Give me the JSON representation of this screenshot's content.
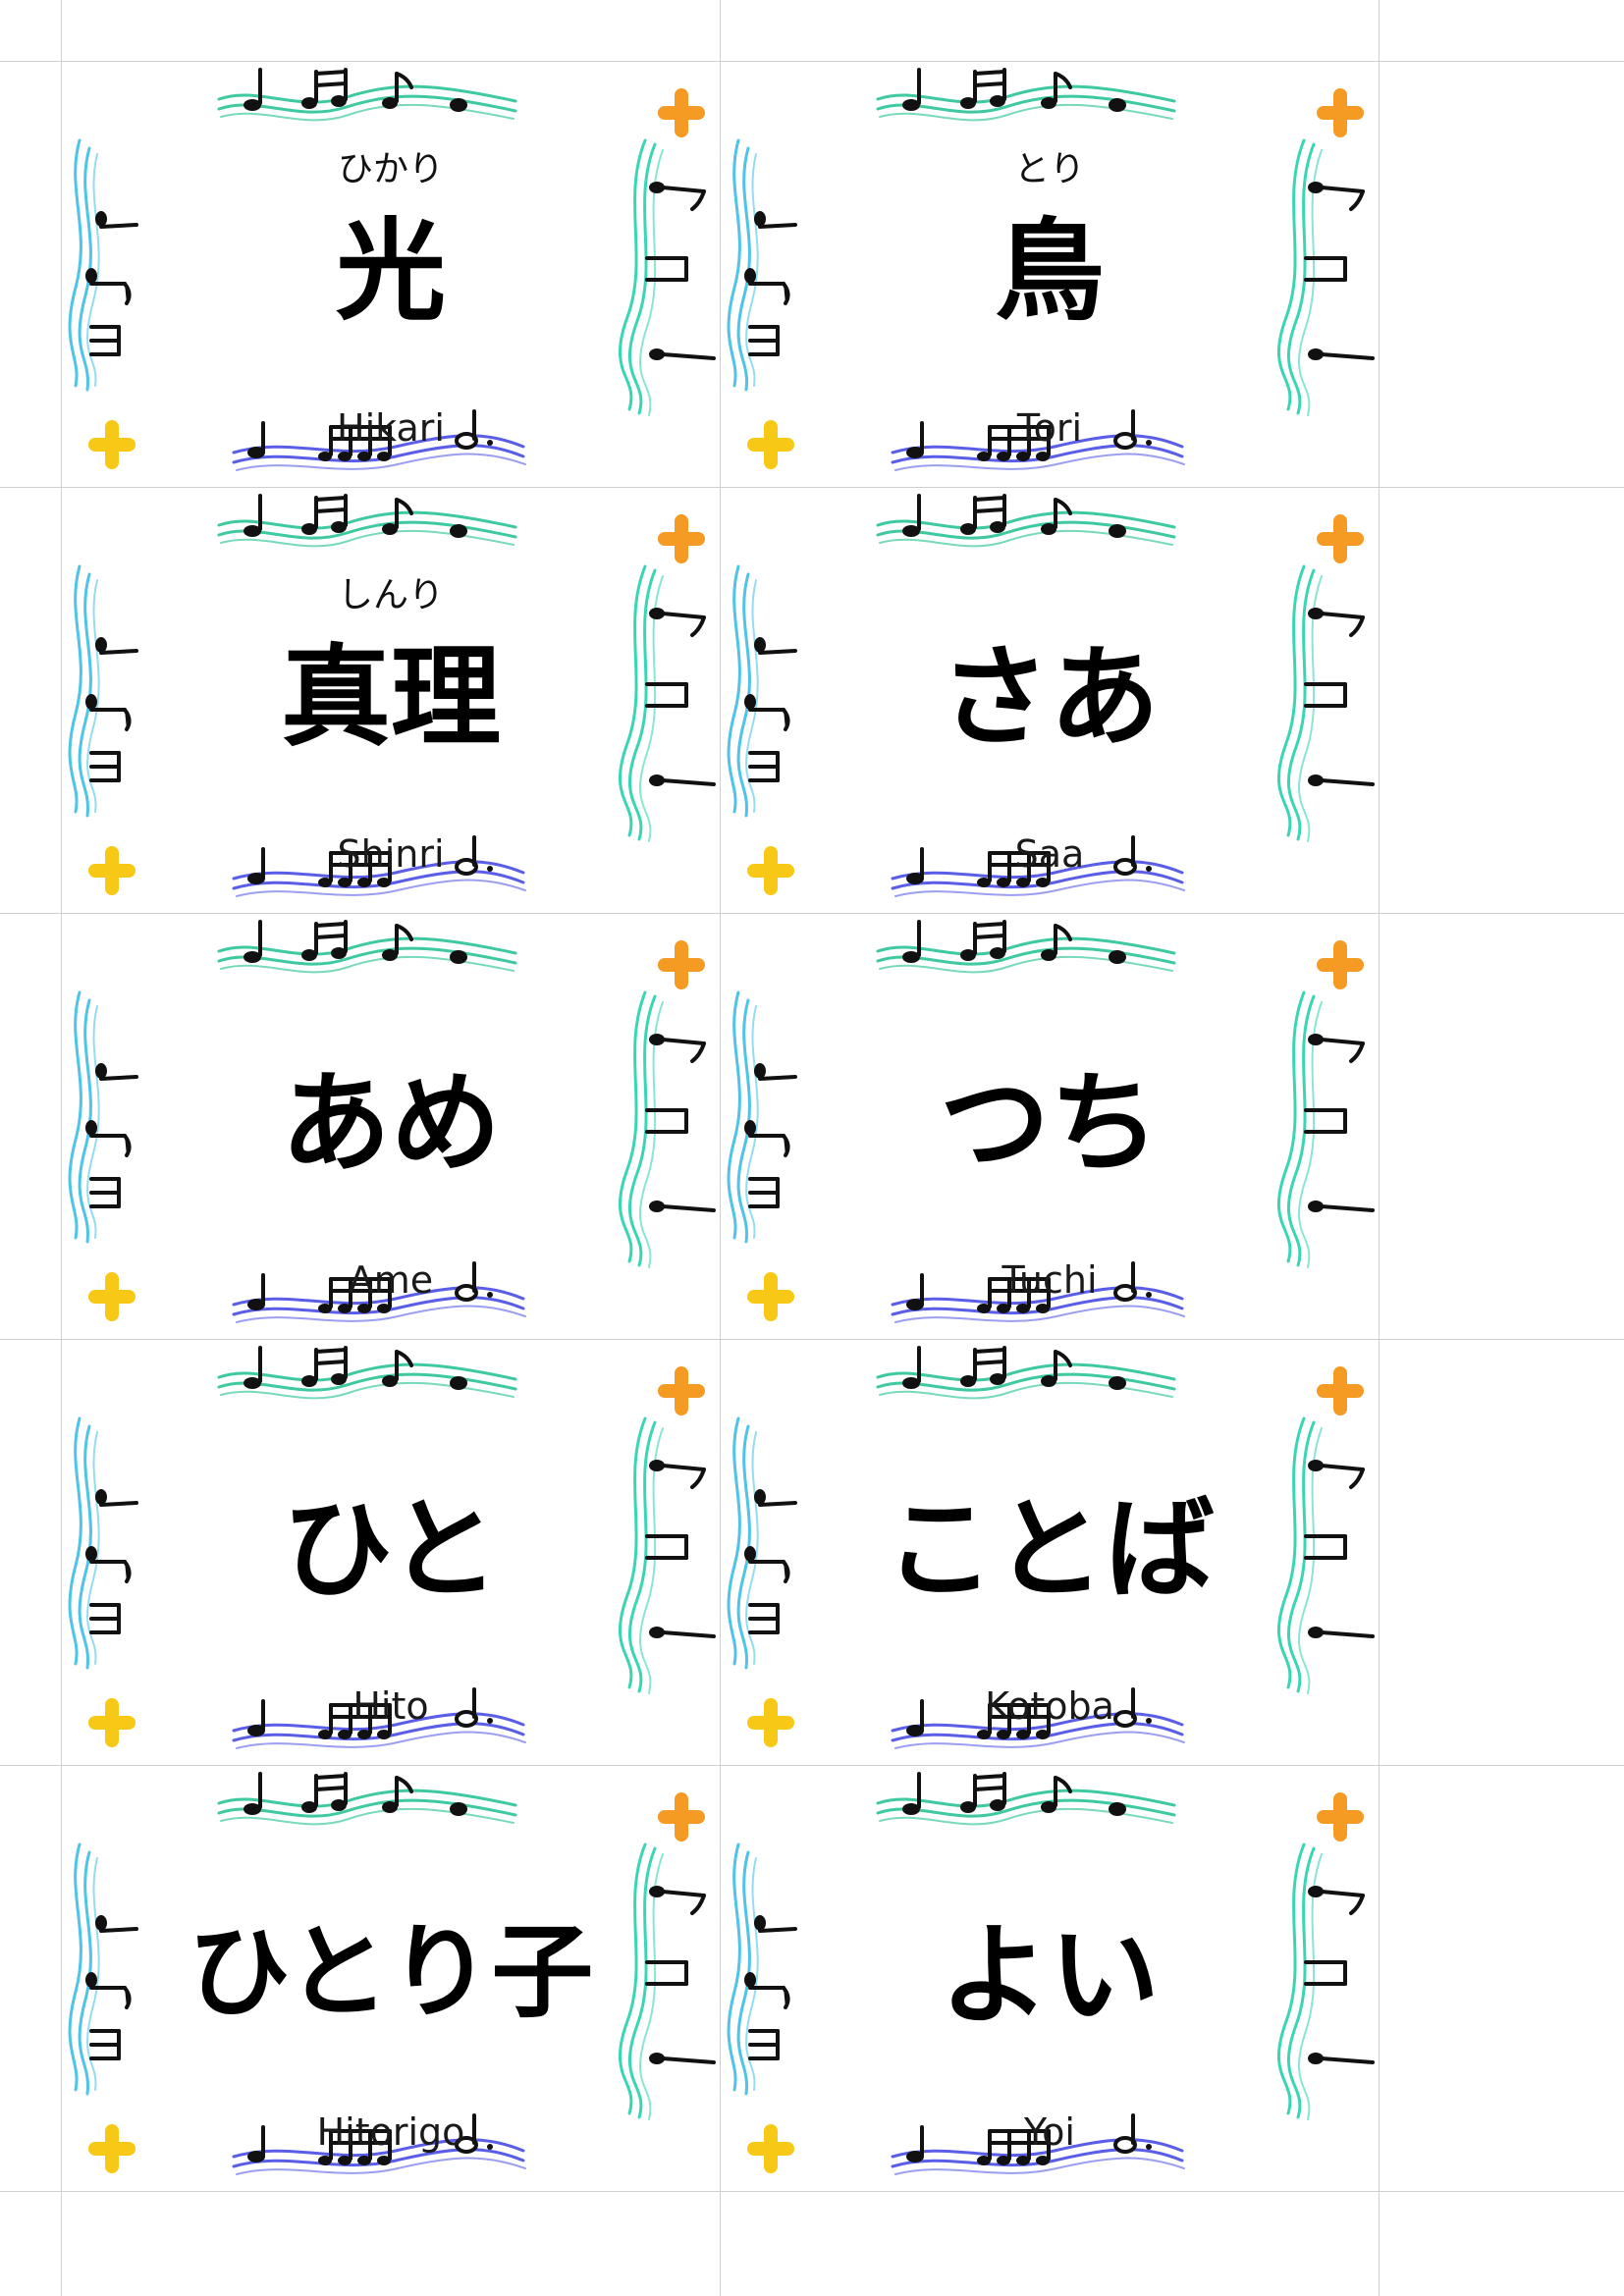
{
  "cards": [
    {
      "reading": "ひかり",
      "word": "光",
      "romaji": "Hikari"
    },
    {
      "reading": "とり",
      "word": "鳥",
      "romaji": "Tori"
    },
    {
      "reading": "しんり",
      "word": "真理",
      "romaji": "Shinri"
    },
    {
      "reading": "",
      "word": "さあ",
      "romaji": "Saa"
    },
    {
      "reading": "",
      "word": "あめ",
      "romaji": "Ame"
    },
    {
      "reading": "",
      "word": "つち",
      "romaji": "Tuchi"
    },
    {
      "reading": "",
      "word": "ひと",
      "romaji": "Hito"
    },
    {
      "reading": "",
      "word": "ことば",
      "romaji": "Kotoba"
    },
    {
      "reading": "",
      "word": "ひとり子",
      "romaji": "Hitorigo"
    },
    {
      "reading": "",
      "word": "よい",
      "romaji": "Yoi"
    }
  ],
  "decoration": {
    "top_staff_color": "#3ec9a0",
    "bottom_staff_color": "#5a5ee6",
    "left_staff_color": "#4fc3e8",
    "right_staff_color": "#3ad6b4",
    "orange_star_color": "#f59a23",
    "yellow_star_color": "#f7c815",
    "icons": [
      "music-note-icon",
      "orange-cross-icon",
      "yellow-cross-icon"
    ]
  }
}
